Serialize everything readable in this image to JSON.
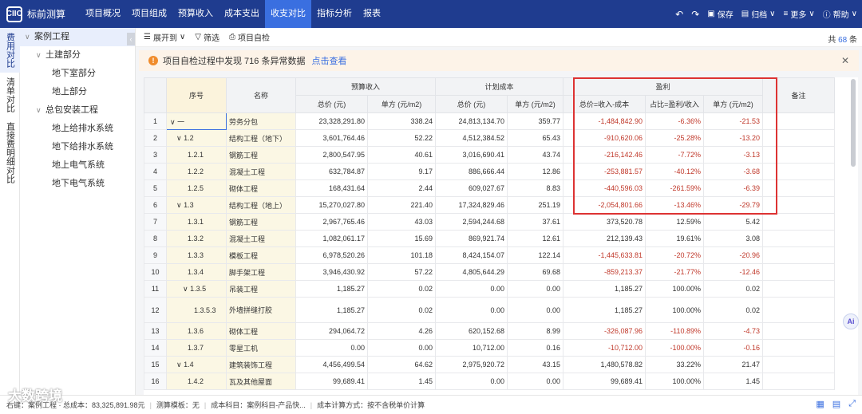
{
  "app": {
    "logo_mark": "CIIO",
    "title": "标前测算"
  },
  "nav": [
    {
      "label": "项目概况",
      "active": false
    },
    {
      "label": "项目组成",
      "active": false
    },
    {
      "label": "预算收入",
      "active": false
    },
    {
      "label": "成本支出",
      "active": false
    },
    {
      "label": "收支对比",
      "active": true
    },
    {
      "label": "指标分析",
      "active": false
    },
    {
      "label": "报表",
      "active": false
    }
  ],
  "top_right": {
    "undo": "↶",
    "redo": "↷",
    "save": "保存",
    "archive": "归档",
    "more": "更多",
    "help": "帮助"
  },
  "vtabs": [
    {
      "label": "费用对比",
      "active": true
    },
    {
      "label": "清单对比",
      "active": false
    },
    {
      "label": "直接费明细对比",
      "active": false
    }
  ],
  "tree": [
    {
      "label": "案例工程",
      "level": 0,
      "caret": "∨",
      "selected": true
    },
    {
      "label": "土建部分",
      "level": 1,
      "caret": "∨",
      "selected": false
    },
    {
      "label": "地下室部分",
      "level": 2,
      "caret": "",
      "selected": false
    },
    {
      "label": "地上部分",
      "level": 2,
      "caret": "",
      "selected": false
    },
    {
      "label": "总包安装工程",
      "level": 1,
      "caret": "∨",
      "selected": false
    },
    {
      "label": "地上给排水系统",
      "level": 2,
      "caret": "",
      "selected": false
    },
    {
      "label": "地下给排水系统",
      "level": 2,
      "caret": "",
      "selected": false
    },
    {
      "label": "地上电气系统",
      "level": 2,
      "caret": "",
      "selected": false
    },
    {
      "label": "地下电气系统",
      "level": 2,
      "caret": "",
      "selected": false
    }
  ],
  "toolbar": {
    "expand": "展开到",
    "filter": "筛选",
    "selfcheck": "项目自检",
    "count_prefix": "共",
    "count": "68",
    "count_suffix": "条"
  },
  "alert": {
    "text": "项目自检过程中发现 716 条异常数据",
    "link": "点击查看"
  },
  "table": {
    "headers": {
      "seq": "序号",
      "name": "名称",
      "budget": "预算收入",
      "plan": "计划成本",
      "profit": "盈利",
      "remark": "备注",
      "total": "总价 (元)",
      "unit": "单方 (元/m2)",
      "profit_total": "总价=收入-成本",
      "profit_ratio": "占比=盈利/收入",
      "profit_unit": "单方 (元/m2)"
    },
    "rows": [
      {
        "n": "1",
        "seq": "∨ 一",
        "name": "劳务分包",
        "b_total": "23,328,291.80",
        "b_unit": "338.24",
        "c_total": "24,813,134.70",
        "c_unit": "359.77",
        "p_total": "-1,484,842.90",
        "p_ratio": "-6.36%",
        "p_unit": "-21.53",
        "neg": true
      },
      {
        "n": "2",
        "seq": "∨ 1.2",
        "name": "结构工程（地下）",
        "b_total": "3,601,764.46",
        "b_unit": "52.22",
        "c_total": "4,512,384.52",
        "c_unit": "65.43",
        "p_total": "-910,620.06",
        "p_ratio": "-25.28%",
        "p_unit": "-13.20",
        "neg": true
      },
      {
        "n": "3",
        "seq": "1.2.1",
        "name": "钢筋工程",
        "b_total": "2,800,547.95",
        "b_unit": "40.61",
        "c_total": "3,016,690.41",
        "c_unit": "43.74",
        "p_total": "-216,142.46",
        "p_ratio": "-7.72%",
        "p_unit": "-3.13",
        "neg": true
      },
      {
        "n": "4",
        "seq": "1.2.2",
        "name": "混凝土工程",
        "b_total": "632,784.87",
        "b_unit": "9.17",
        "c_total": "886,666.44",
        "c_unit": "12.86",
        "p_total": "-253,881.57",
        "p_ratio": "-40.12%",
        "p_unit": "-3.68",
        "neg": true
      },
      {
        "n": "5",
        "seq": "1.2.5",
        "name": "砌体工程",
        "b_total": "168,431.64",
        "b_unit": "2.44",
        "c_total": "609,027.67",
        "c_unit": "8.83",
        "p_total": "-440,596.03",
        "p_ratio": "-261.59%",
        "p_unit": "-6.39",
        "neg": true
      },
      {
        "n": "6",
        "seq": "∨ 1.3",
        "name": "结构工程（地上）",
        "b_total": "15,270,027.80",
        "b_unit": "221.40",
        "c_total": "17,324,829.46",
        "c_unit": "251.19",
        "p_total": "-2,054,801.66",
        "p_ratio": "-13.46%",
        "p_unit": "-29.79",
        "neg": true
      },
      {
        "n": "7",
        "seq": "1.3.1",
        "name": "钢筋工程",
        "b_total": "2,967,765.46",
        "b_unit": "43.03",
        "c_total": "2,594,244.68",
        "c_unit": "37.61",
        "p_total": "373,520.78",
        "p_ratio": "12.59%",
        "p_unit": "5.42",
        "neg": false
      },
      {
        "n": "8",
        "seq": "1.3.2",
        "name": "混凝土工程",
        "b_total": "1,082,061.17",
        "b_unit": "15.69",
        "c_total": "869,921.74",
        "c_unit": "12.61",
        "p_total": "212,139.43",
        "p_ratio": "19.61%",
        "p_unit": "3.08",
        "neg": false
      },
      {
        "n": "9",
        "seq": "1.3.3",
        "name": "模板工程",
        "b_total": "6,978,520.26",
        "b_unit": "101.18",
        "c_total": "8,424,154.07",
        "c_unit": "122.14",
        "p_total": "-1,445,633.81",
        "p_ratio": "-20.72%",
        "p_unit": "-20.96",
        "neg": true
      },
      {
        "n": "10",
        "seq": "1.3.4",
        "name": "脚手架工程",
        "b_total": "3,946,430.92",
        "b_unit": "57.22",
        "c_total": "4,805,644.29",
        "c_unit": "69.68",
        "p_total": "-859,213.37",
        "p_ratio": "-21.77%",
        "p_unit": "-12.46",
        "neg": true
      },
      {
        "n": "11",
        "seq": "∨ 1.3.5",
        "name": "吊装工程",
        "b_total": "1,185.27",
        "b_unit": "0.02",
        "c_total": "0.00",
        "c_unit": "0.00",
        "p_total": "1,185.27",
        "p_ratio": "100.00%",
        "p_unit": "0.02",
        "neg": false
      },
      {
        "n": "12",
        "seq": "1.3.5.3",
        "name": "外墙拼缝打胶",
        "b_total": "1,185.27",
        "b_unit": "0.02",
        "c_total": "0.00",
        "c_unit": "0.00",
        "p_total": "1,185.27",
        "p_ratio": "100.00%",
        "p_unit": "0.02",
        "neg": false,
        "tall": true
      },
      {
        "n": "13",
        "seq": "1.3.6",
        "name": "砌体工程",
        "b_total": "294,064.72",
        "b_unit": "4.26",
        "c_total": "620,152.68",
        "c_unit": "8.99",
        "p_total": "-326,087.96",
        "p_ratio": "-110.89%",
        "p_unit": "-4.73",
        "neg": true
      },
      {
        "n": "14",
        "seq": "1.3.7",
        "name": "零星工机",
        "b_total": "0.00",
        "b_unit": "0.00",
        "c_total": "10,712.00",
        "c_unit": "0.16",
        "p_total": "-10,712.00",
        "p_ratio": "-100.00%",
        "p_unit": "-0.16",
        "neg": true
      },
      {
        "n": "15",
        "seq": "∨ 1.4",
        "name": "建筑装饰工程",
        "b_total": "4,456,499.54",
        "b_unit": "64.62",
        "c_total": "2,975,920.72",
        "c_unit": "43.15",
        "p_total": "1,480,578.82",
        "p_ratio": "33.22%",
        "p_unit": "21.47",
        "neg": false
      },
      {
        "n": "16",
        "seq": "1.4.2",
        "name": "瓦及其他屋面",
        "b_total": "99,689.41",
        "b_unit": "1.45",
        "c_total": "0.00",
        "c_unit": "0.00",
        "p_total": "99,689.41",
        "p_ratio": "100.00%",
        "p_unit": "1.45",
        "neg": false
      }
    ]
  },
  "statusbar": {
    "item1": "右键：案例工程 · 总成本：83,325,891.98元",
    "item2": "测算模板：无",
    "item3": "成本科目：案例科目-产品快...",
    "item4": "成本计算方式：按不含税单价计算"
  },
  "ai_badge": "Ai",
  "watermark": "大数跨境",
  "colors": {
    "topbar": "#1f3c8f",
    "active_tab": "#3a6fe0",
    "negative": "#c0392b",
    "highlight_border": "#dd3333"
  }
}
